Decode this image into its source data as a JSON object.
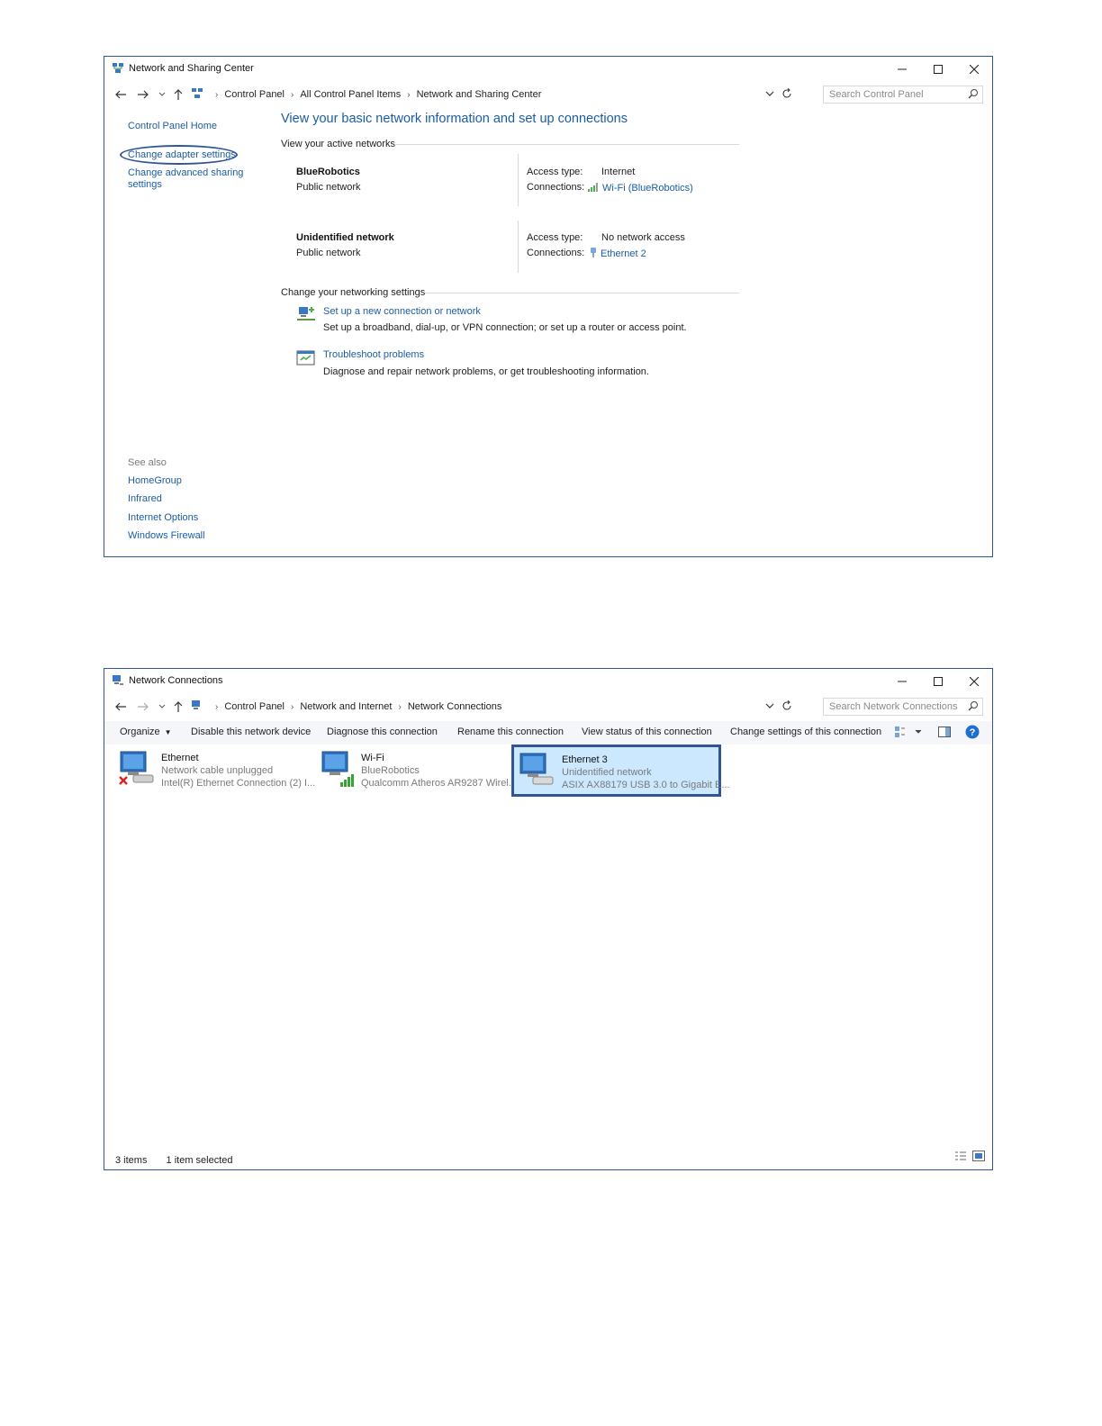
{
  "colors": {
    "link": "#1a5da3",
    "accent_border": "#2f5597",
    "selected_bg": "#cce8ff",
    "cmdbar_bg": "#f4f6fa"
  },
  "window1": {
    "title": "Network and Sharing Center",
    "breadcrumb": [
      "Control Panel",
      "All Control Panel Items",
      "Network and Sharing Center"
    ],
    "search_placeholder": "Search Control Panel",
    "left_pane": {
      "home": "Control Panel Home",
      "links": [
        "Change adapter settings",
        "Change advanced sharing",
        "settings"
      ],
      "see_also_title": "See also",
      "see_also": [
        "HomeGroup",
        "Infrared",
        "Internet Options",
        "Windows Firewall"
      ]
    },
    "heading": "View your basic network information and set up connections",
    "active_networks_label": "View your active networks",
    "networks": [
      {
        "name": "BlueRobotics",
        "type": "Public network",
        "access_key": "Access type:",
        "access_val": "Internet",
        "conn_key": "Connections:",
        "conn_val": "Wi-Fi (BlueRobotics)",
        "conn_icon": "wifi-signal-icon"
      },
      {
        "name": "Unidentified network",
        "type": "Public network",
        "access_key": "Access type:",
        "access_val": "No network access",
        "conn_key": "Connections:",
        "conn_val": "Ethernet 2",
        "conn_icon": "ethernet-plug-icon"
      }
    ],
    "change_settings_label": "Change your networking settings",
    "tasks": [
      {
        "link": "Set up a new connection or network",
        "desc": "Set up a broadband, dial-up, or VPN connection; or set up a router or access point.",
        "icon": "new-connection-icon"
      },
      {
        "link": "Troubleshoot problems",
        "desc": "Diagnose and repair network problems, or get troubleshooting information.",
        "icon": "troubleshoot-icon"
      }
    ]
  },
  "window2": {
    "title": "Network Connections",
    "breadcrumb": [
      "Control Panel",
      "Network and Internet",
      "Network Connections"
    ],
    "search_placeholder": "Search Network Connections",
    "commands": [
      "Organize",
      "Disable this network device",
      "Diagnose this connection",
      "Rename this connection",
      "View status of this connection",
      "Change settings of this connection"
    ],
    "adapters": [
      {
        "name": "Ethernet",
        "status": "Network cable unplugged",
        "device": "Intel(R) Ethernet Connection (2) I...",
        "icon": "ethernet-disconnected-icon"
      },
      {
        "name": "Wi-Fi",
        "status": "BlueRobotics",
        "device": "Qualcomm Atheros AR9287 Wirel...",
        "icon": "wifi-adapter-icon"
      },
      {
        "name": "Ethernet 3",
        "status": "Unidentified network",
        "device": "ASIX AX88179 USB 3.0 to Gigabit E...",
        "icon": "ethernet-adapter-icon",
        "selected": true
      }
    ],
    "status": {
      "items": "3 items",
      "selected": "1 item selected"
    }
  }
}
